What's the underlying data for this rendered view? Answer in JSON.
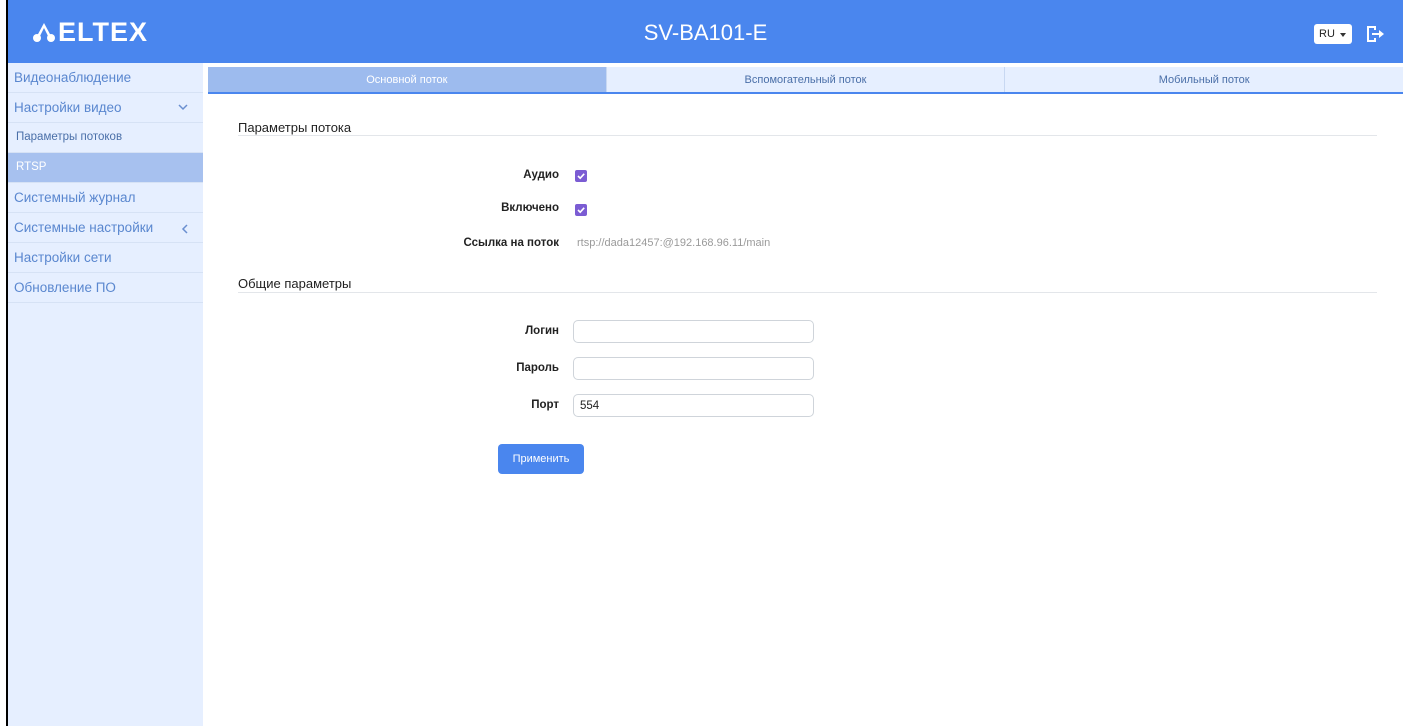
{
  "header": {
    "logo_text": "ELTEX",
    "device_name": "SV-BA101-E",
    "lang": "RU"
  },
  "sidebar": {
    "items": [
      {
        "label": "Видеонаблюдение"
      },
      {
        "label": "Настройки видео"
      },
      {
        "label": "Параметры потоков"
      },
      {
        "label": "RTSP"
      },
      {
        "label": "Системный журнал"
      },
      {
        "label": "Системные настройки"
      },
      {
        "label": "Настройки сети"
      },
      {
        "label": "Обновление ПО"
      }
    ]
  },
  "tabs": [
    {
      "label": "Основной поток"
    },
    {
      "label": "Вспомогательный поток"
    },
    {
      "label": "Мобильный поток"
    }
  ],
  "stream_params": {
    "title": "Параметры потока",
    "audio_label": "Аудио",
    "audio_checked": true,
    "enabled_label": "Включено",
    "enabled_checked": true,
    "link_label": "Ссылка на поток",
    "link_value": "rtsp://dada12457:@192.168.96.11/main"
  },
  "general_params": {
    "title": "Общие параметры",
    "login_label": "Логин",
    "login_value": "",
    "password_label": "Пароль",
    "password_value": "",
    "port_label": "Порт",
    "port_value": "554"
  },
  "apply_label": "Применить",
  "colors": {
    "header_bg": "#4a86ee",
    "sidebar_bg": "#e6efff",
    "active_item": "#a7c1ef",
    "checkbox": "#7b5cd3"
  }
}
